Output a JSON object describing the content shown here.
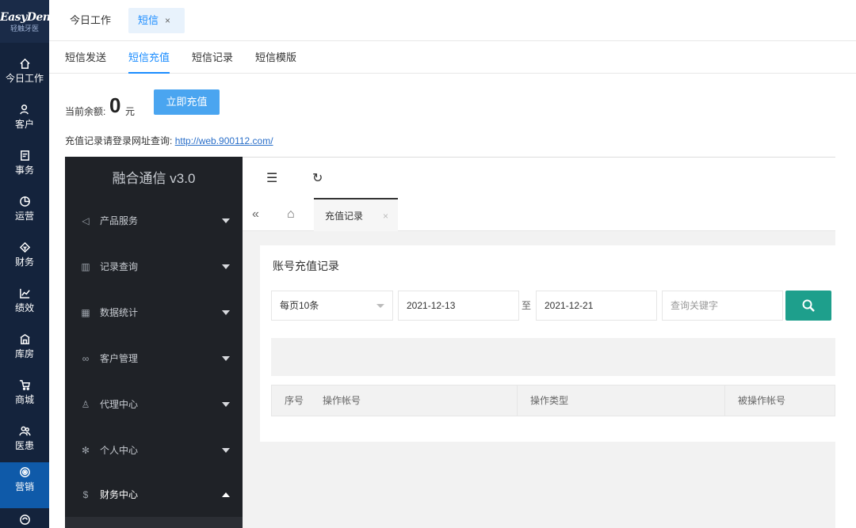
{
  "app": {
    "logo_line1": "EasyDent",
    "logo_line2": "轻触牙医"
  },
  "leftnav": [
    {
      "label": "今日工作",
      "icon": "home-icon"
    },
    {
      "label": "客户",
      "icon": "user-icon"
    },
    {
      "label": "事务",
      "icon": "task-icon"
    },
    {
      "label": "运营",
      "icon": "clock-chart-icon"
    },
    {
      "label": "财务",
      "icon": "finance-icon"
    },
    {
      "label": "绩效",
      "icon": "line-chart-icon"
    },
    {
      "label": "库房",
      "icon": "warehouse-icon"
    },
    {
      "label": "商城",
      "icon": "cart-icon"
    },
    {
      "label": "医患",
      "icon": "doctor-patient-icon"
    },
    {
      "label": "营销",
      "icon": "target-icon",
      "active": true
    },
    {
      "label": "",
      "icon": "more-icon"
    }
  ],
  "top_tabs": {
    "today": "今日工作",
    "sms": "短信",
    "close": "×"
  },
  "sub_tabs": [
    "短信发送",
    "短信充值",
    "短信记录",
    "短信模版"
  ],
  "balance": {
    "label": "当前余额:",
    "value": "0",
    "unit": "元",
    "recharge_button": "立即充值"
  },
  "hint": {
    "text": "充值记录请登录网址查询:",
    "link": "http://web.900112.com/"
  },
  "embedded": {
    "title": "融合通信 v3.0",
    "menu": [
      {
        "label": "产品服务",
        "icon": "send-icon",
        "open": false
      },
      {
        "label": "记录查询",
        "icon": "book-icon",
        "open": false
      },
      {
        "label": "数据统计",
        "icon": "stats-icon",
        "open": false
      },
      {
        "label": "客户管理",
        "icon": "handshake-icon",
        "open": false
      },
      {
        "label": "代理中心",
        "icon": "agent-icon",
        "open": false
      },
      {
        "label": "个人中心",
        "icon": "settings-icon",
        "open": false
      },
      {
        "label": "财务中心",
        "icon": "dollar-icon",
        "open": true
      }
    ],
    "tab_active": "充值记录",
    "tab_close": "×",
    "card_title": "账号充值记录",
    "filters": {
      "page_size": "每页10条",
      "start_date": "2021-12-13",
      "separator": "至",
      "end_date": "2021-12-21",
      "keyword_placeholder": "查询关键字"
    },
    "table_headers": [
      "序号",
      "操作帐号",
      "操作类型",
      "被操作帐号"
    ]
  }
}
